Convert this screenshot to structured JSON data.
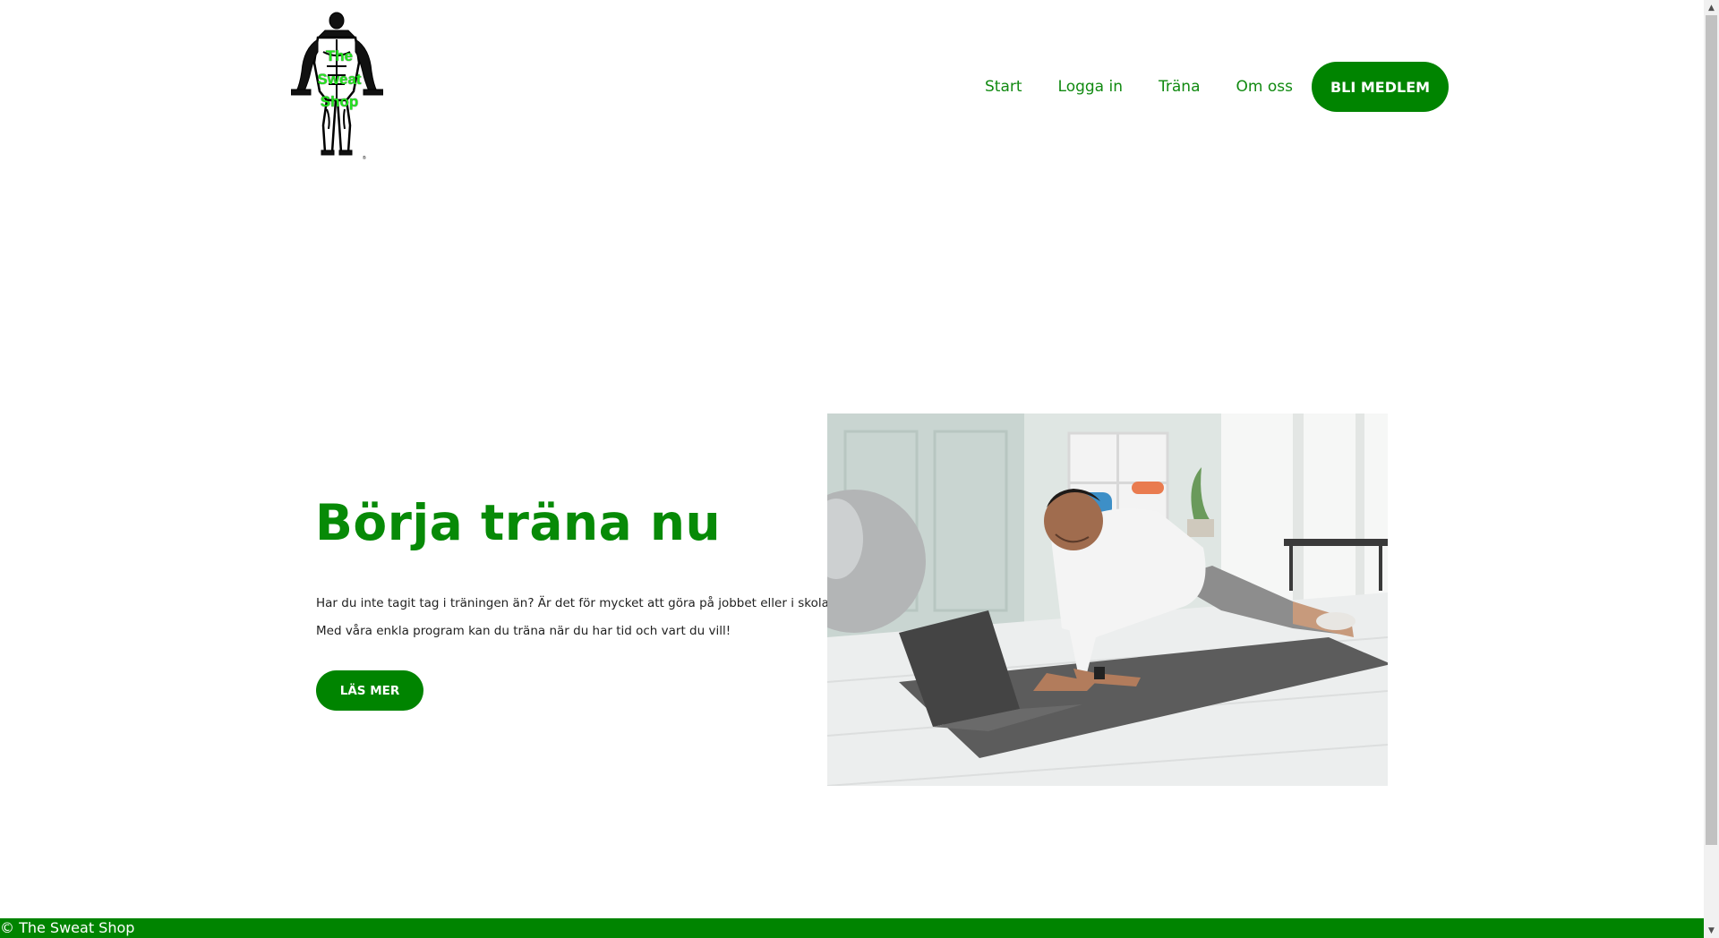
{
  "brand": {
    "logo_text": [
      "The",
      "Sweat",
      "Shop"
    ],
    "accent_color": "#008400",
    "heading_color": "#078a07"
  },
  "nav": {
    "links": [
      "Start",
      "Logga in",
      "Träna",
      "Om oss"
    ],
    "cta_label": "BLI MEDLEM"
  },
  "hero": {
    "title": "Börja träna nu",
    "paragraph_lines": [
      "Har du inte tagit tag i träningen än? Är det för mycket att göra på jobbet eller i skolan?",
      "Med våra enkla program kan du träna när du har tid och vart du vill!"
    ],
    "button_label": "LÄS MER",
    "image_subject": "man-doing-plank-with-laptop-on-yoga-mat"
  },
  "footer": {
    "text": "© The Sweat Shop"
  },
  "scrollbar": {
    "up_icon": "triangle-up",
    "down_icon": "triangle-down"
  }
}
